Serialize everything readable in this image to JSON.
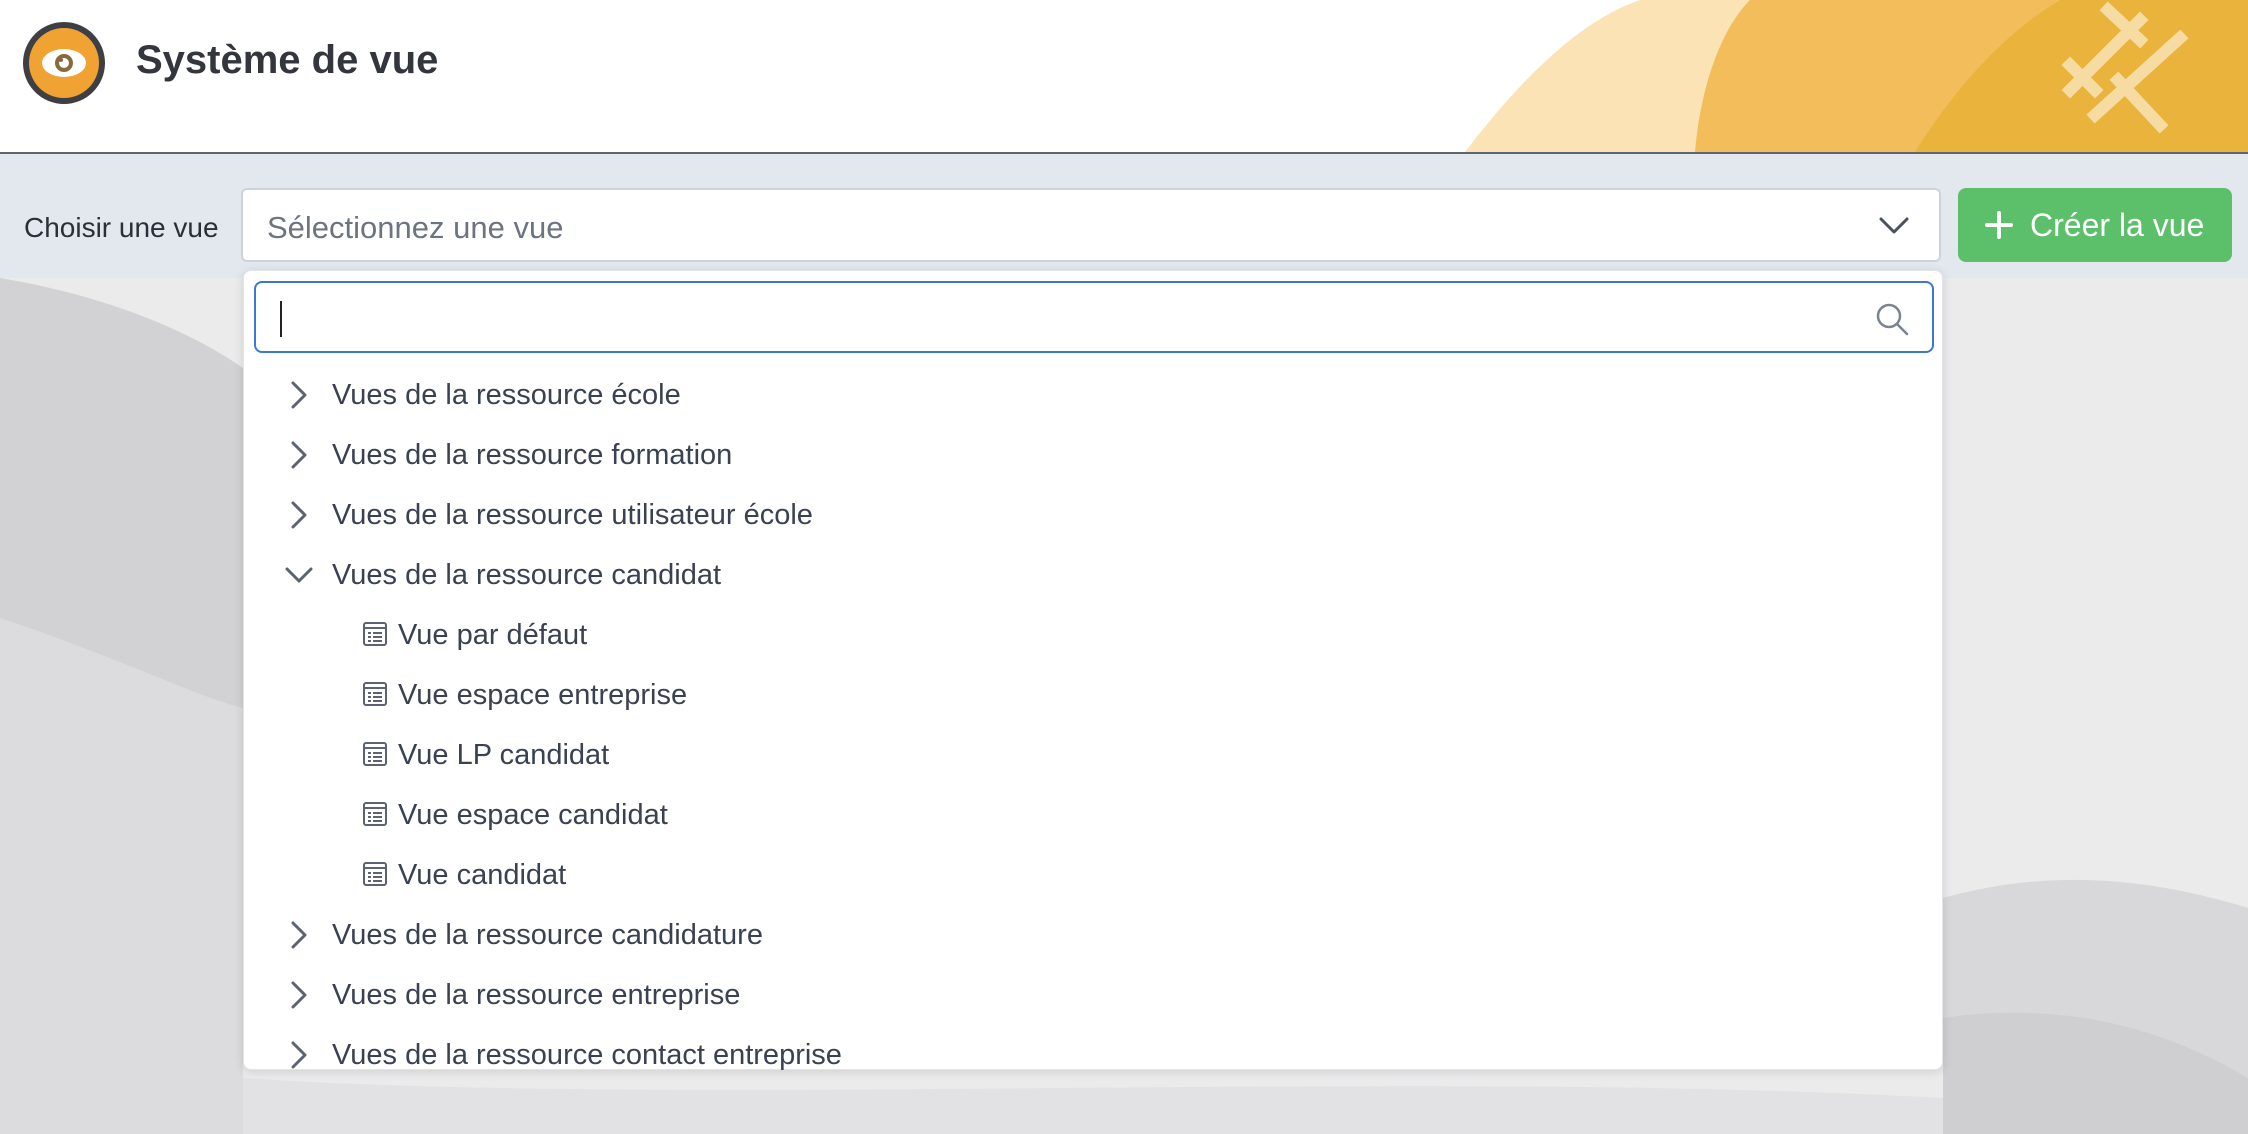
{
  "header": {
    "title": "Système de vue"
  },
  "toolbar": {
    "choose_label": "Choisir une vue",
    "select_placeholder": "Sélectionnez une vue",
    "create_button_label": "Créer la vue"
  },
  "dropdown": {
    "search_value": "",
    "groups": [
      {
        "label": "Vues de la ressource école",
        "expanded": false
      },
      {
        "label": "Vues de la ressource formation",
        "expanded": false
      },
      {
        "label": "Vues de la ressource utilisateur école",
        "expanded": false
      },
      {
        "label": "Vues de la ressource candidat",
        "expanded": true,
        "items": [
          "Vue par défaut",
          "Vue espace entreprise",
          "Vue LP candidat",
          "Vue espace candidat",
          "Vue candidat"
        ]
      },
      {
        "label": "Vues de la ressource candidature",
        "expanded": false
      },
      {
        "label": "Vues de la ressource entreprise",
        "expanded": false
      },
      {
        "label": "Vues de la ressource contact entreprise",
        "expanded": false
      }
    ]
  },
  "colors": {
    "accent_green": "#5cbf6a",
    "focus_blue": "#3a78d4",
    "logo_orange": "#f0a232"
  }
}
